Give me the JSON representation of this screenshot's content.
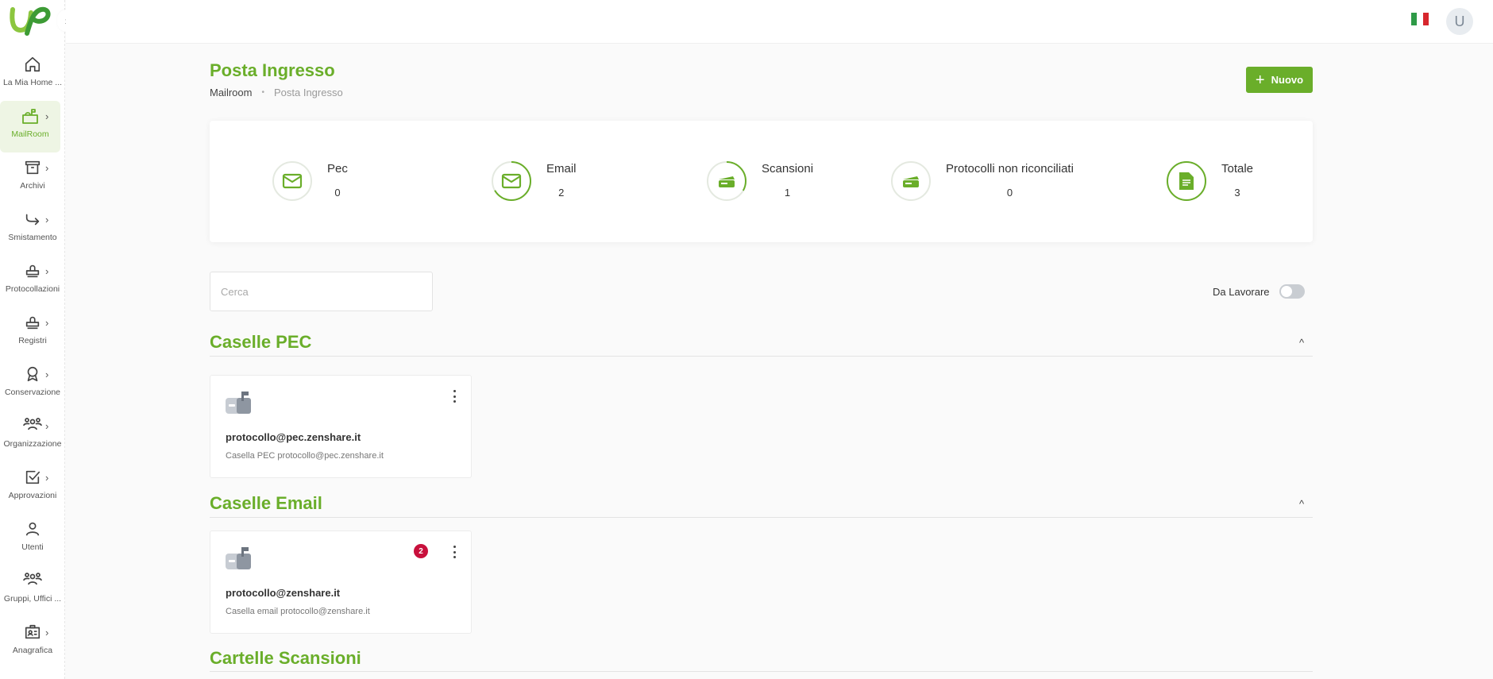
{
  "sidebar": {
    "items": [
      {
        "label": "La Mia Home ...",
        "icon": "home-icon",
        "chevron": false,
        "active": false
      },
      {
        "label": "MailRoom",
        "icon": "mailbox-icon",
        "chevron": true,
        "active": true
      },
      {
        "label": "Archivi",
        "icon": "archive-icon",
        "chevron": true,
        "active": false
      },
      {
        "label": "Smistamento",
        "icon": "forward-arrow-icon",
        "chevron": true,
        "active": false
      },
      {
        "label": "Protocollazioni",
        "icon": "stamp-icon",
        "chevron": true,
        "active": false
      },
      {
        "label": "Registri",
        "icon": "stamp-icon",
        "chevron": true,
        "active": false
      },
      {
        "label": "Conservazione",
        "icon": "award-icon",
        "chevron": true,
        "active": false
      },
      {
        "label": "Organizzazione",
        "icon": "organization-icon",
        "chevron": true,
        "active": false
      },
      {
        "label": "Approvazioni",
        "icon": "checkbox-icon",
        "chevron": true,
        "active": false
      },
      {
        "label": "Utenti",
        "icon": "user-icon",
        "chevron": false,
        "active": false
      },
      {
        "label": "Gruppi, Uffici ...",
        "icon": "group-icon",
        "chevron": false,
        "active": false
      },
      {
        "label": "Anagrafica",
        "icon": "id-card-icon",
        "chevron": true,
        "active": false
      }
    ],
    "collapse_glyph": "›",
    "chevron_glyph": "›"
  },
  "topbar": {
    "avatar_initial": "U",
    "flag_colors": [
      "#2e9a47",
      "#ffffff",
      "#d7262d"
    ]
  },
  "header": {
    "title": "Posta Ingresso",
    "breadcrumb": [
      "Mailroom",
      "Posta Ingresso"
    ],
    "breadcrumb_separator": "•",
    "new_button": "Nuovo",
    "new_button_icon": "+"
  },
  "stats": [
    {
      "label": "Pec",
      "value": "0",
      "icon": "envelope-icon",
      "progress": 0
    },
    {
      "label": "Email",
      "value": "2",
      "icon": "envelope-icon",
      "progress": 0.667
    },
    {
      "label": "Scansioni",
      "value": "1",
      "icon": "scanner-icon",
      "progress": 0.333
    },
    {
      "label": "Protocolli non riconciliati",
      "value": "0",
      "icon": "scanner-icon",
      "progress": 0
    },
    {
      "label": "Totale",
      "value": "3",
      "icon": "document-icon",
      "progress": 1
    }
  ],
  "search": {
    "placeholder": "Cerca",
    "value": ""
  },
  "toggle": {
    "label": "Da Lavorare",
    "on": false
  },
  "sections": [
    {
      "title": "Caselle PEC",
      "caret": "^",
      "cards": [
        {
          "address": "protocollo@pec.zenshare.it",
          "description": "Casella PEC protocollo@pec.zenshare.it",
          "badge": ""
        }
      ]
    },
    {
      "title": "Caselle Email",
      "caret": "^",
      "cards": [
        {
          "address": "protocollo@zenshare.it",
          "description": "Casella email protocollo@zenshare.it",
          "badge": "2"
        }
      ]
    },
    {
      "title": "Cartelle Scansioni",
      "caret": "",
      "cards": []
    }
  ],
  "colors": {
    "accent": "#6aae2a",
    "badge": "#c8103c",
    "ring_track": "#e4e9e0"
  }
}
